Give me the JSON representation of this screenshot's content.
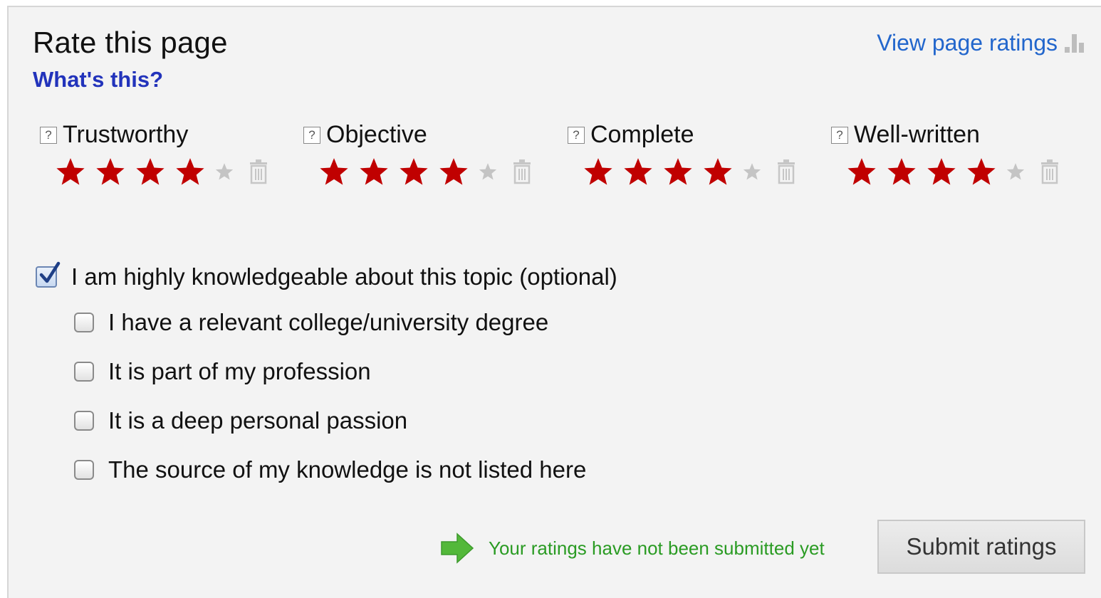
{
  "header": {
    "title": "Rate this page",
    "whats_this": "What's this?",
    "view_ratings": "View page ratings"
  },
  "categories": [
    {
      "label": "Trustworthy",
      "rating": 4,
      "max": 5
    },
    {
      "label": "Objective",
      "rating": 4,
      "max": 5
    },
    {
      "label": "Complete",
      "rating": 4,
      "max": 5
    },
    {
      "label": "Well-written",
      "rating": 4,
      "max": 5
    }
  ],
  "knowledge": {
    "main": {
      "label": "I am highly knowledgeable about this topic (optional)",
      "checked": true
    },
    "options": [
      {
        "label": "I have a relevant college/university degree",
        "checked": false
      },
      {
        "label": "It is part of my profession",
        "checked": false
      },
      {
        "label": "It is a deep personal passion",
        "checked": false
      },
      {
        "label": "The source of my knowledge is not listed here",
        "checked": false
      }
    ]
  },
  "status": {
    "message": "Your ratings have not been submitted yet"
  },
  "submit": {
    "label": "Submit ratings"
  },
  "colors": {
    "star_filled": "#c00000",
    "star_empty": "#c4c4c4",
    "link": "#2233bb",
    "status_green": "#2a9b23"
  },
  "icons": {
    "help": "question-mark-box-icon",
    "star": "star-icon",
    "clear": "trash-icon",
    "ratings_chart": "bar-chart-icon",
    "arrow": "green-arrow-icon",
    "checkmark": "checkmark-icon"
  }
}
